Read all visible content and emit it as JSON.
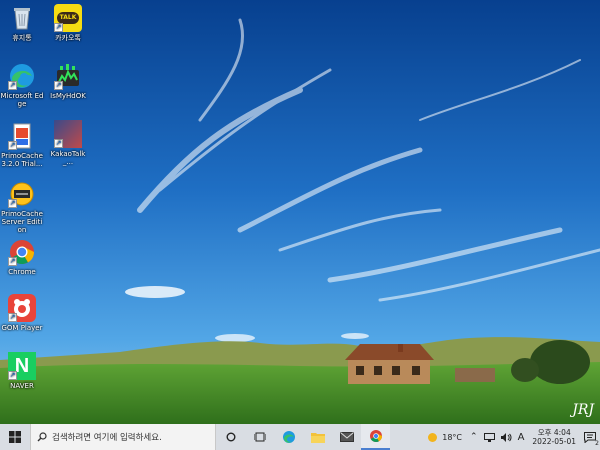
{
  "desktop": {
    "icons": [
      {
        "label": "휴지통",
        "icon": "recycle-bin-icon"
      },
      {
        "label": "카카오톡",
        "icon": "kakaotalk-icon"
      },
      {
        "label": "Microsoft Edge",
        "icon": "edge-icon"
      },
      {
        "label": "IsMyHdOK",
        "icon": "hdd-icon"
      },
      {
        "label": "PrimoCache 3.2.0 Trial...",
        "icon": "primocache-icon"
      },
      {
        "label": "KakaoTalk_...",
        "icon": "kakaotalk-file-icon"
      },
      {
        "label": "PrimoCache Server Edition",
        "icon": "primocache-server-icon"
      },
      {
        "label": "Chrome",
        "icon": "chrome-icon"
      },
      {
        "label": "GOM Player",
        "icon": "gom-player-icon"
      },
      {
        "label": "NAVER",
        "icon": "naver-icon"
      }
    ],
    "kakao_badge": "TALK",
    "naver_letter": "N",
    "signature": "JRJ"
  },
  "taskbar": {
    "search_placeholder": "검색하려면 여기에 입력하세요.",
    "weather": "18°C",
    "ime": "A",
    "time": "오후 4:04",
    "date": "2022-05-01",
    "notification_count": "2"
  },
  "colors": {
    "sky_top": "#0b4a9a",
    "sky_mid": "#2d8bd8",
    "grass": "#4b8f2a",
    "taskbar": "#d9dde3"
  }
}
